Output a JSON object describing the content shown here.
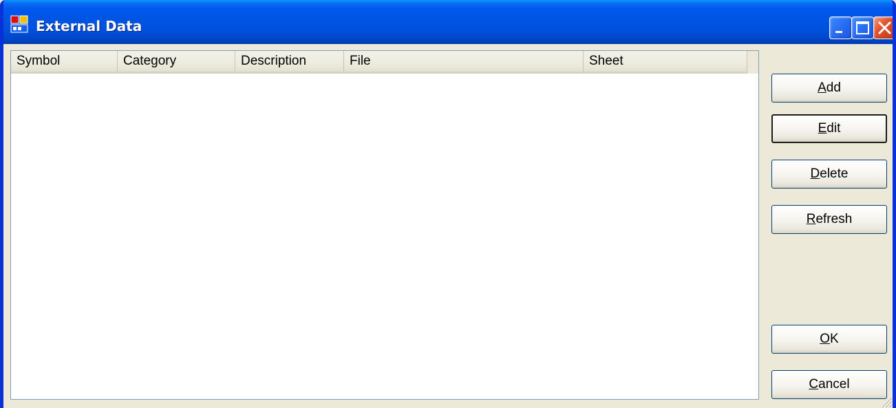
{
  "window": {
    "title": "External Data",
    "icon": "app-window-icon",
    "caption_buttons": [
      "minimize",
      "maximize",
      "close"
    ]
  },
  "list": {
    "columns": [
      "Symbol",
      "Category",
      "Description",
      "File",
      "Sheet"
    ],
    "rows": []
  },
  "buttons": {
    "add": {
      "mnemonic": "A",
      "rest": "dd"
    },
    "edit": {
      "mnemonic": "E",
      "rest": "dit"
    },
    "delete": {
      "mnemonic": "D",
      "rest": "elete"
    },
    "refresh": {
      "mnemonic": "R",
      "rest": "efresh"
    },
    "ok": {
      "mnemonic": "O",
      "rest": "K"
    },
    "cancel": {
      "mnemonic": "C",
      "rest": "ancel"
    }
  },
  "colors": {
    "titlebar": "#0054e3",
    "frame": "#0831d9",
    "dialog_bg": "#ece9d8",
    "close_button": "#e2522c"
  }
}
